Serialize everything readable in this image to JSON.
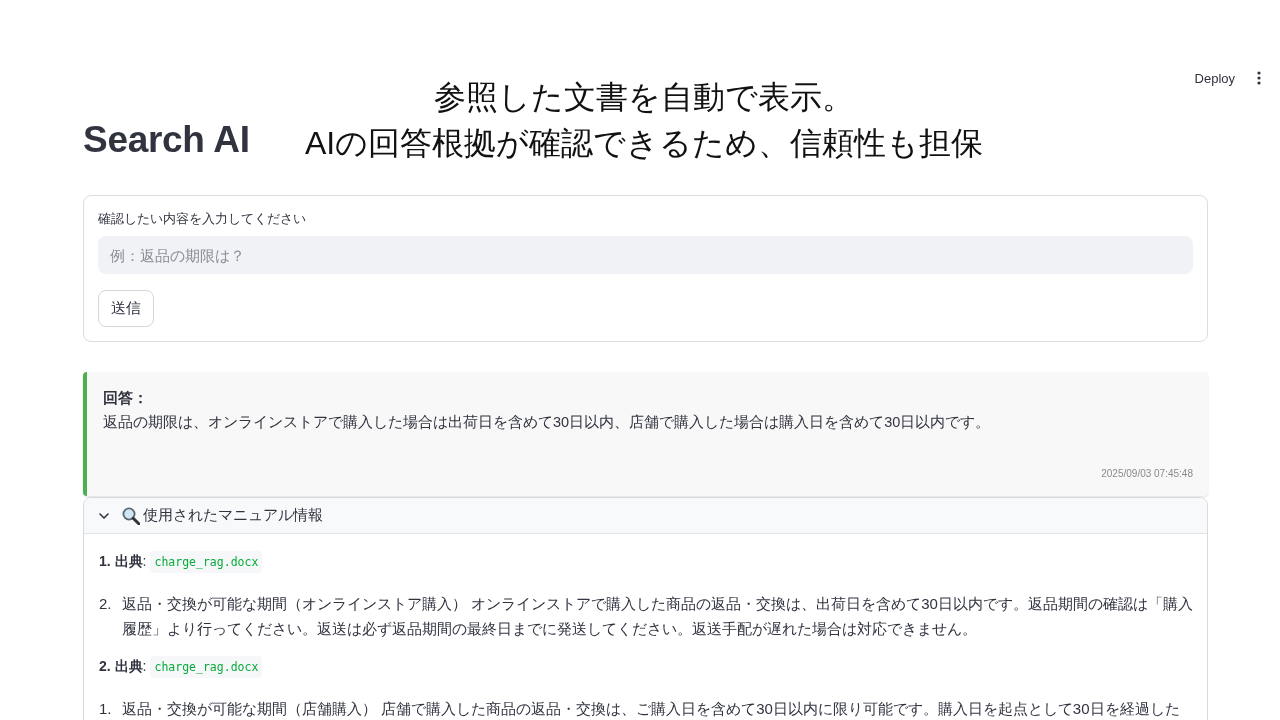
{
  "header": {
    "deploy_label": "Deploy"
  },
  "caption": {
    "lines": [
      "参照した文書を自動で表示。",
      "AIの回答根拠が確認できるため、信頼性も担保"
    ]
  },
  "title": "Search AI",
  "query_form": {
    "label": "確認したい内容を入力してください",
    "placeholder": "例：返品の期限は？",
    "submit_label": "送信"
  },
  "answer": {
    "heading": "回答：",
    "text": "返品の期限は、オンラインストアで購入した場合は出荷日を含めて30日以内、店舗で購入した場合は購入日を含めて30日以内です。",
    "timestamp": "2025/09/03 07:45:48"
  },
  "sources": {
    "title": "使用されたマニュアル情報",
    "expanded": true,
    "entries": [
      {
        "label": "**1. 出典**:",
        "file": "charge_rag.docx",
        "items": [
          {
            "number": "2.",
            "text": "返品・交換が可能な期間（オンラインストア購入） オンラインストアで購入した商品の返品・交換は、出荷日を含めて30日以内です。返品期間の確認は「購入履歴」より行ってください。返送は必ず返品期間の最終日までに発送してください。返送手配が遅れた場合は対応できません。"
          }
        ]
      },
      {
        "label": "**2. 出典**:",
        "file": "charge_rag.docx",
        "items": [
          {
            "number": "1.",
            "text": "返品・交換が可能な期間（店舗購入） 店舗で購入した商品の返品・交換は、ご購入日を含めて30日以内に限り可能です。購入日を起点として30日を経過した"
          }
        ]
      }
    ]
  }
}
